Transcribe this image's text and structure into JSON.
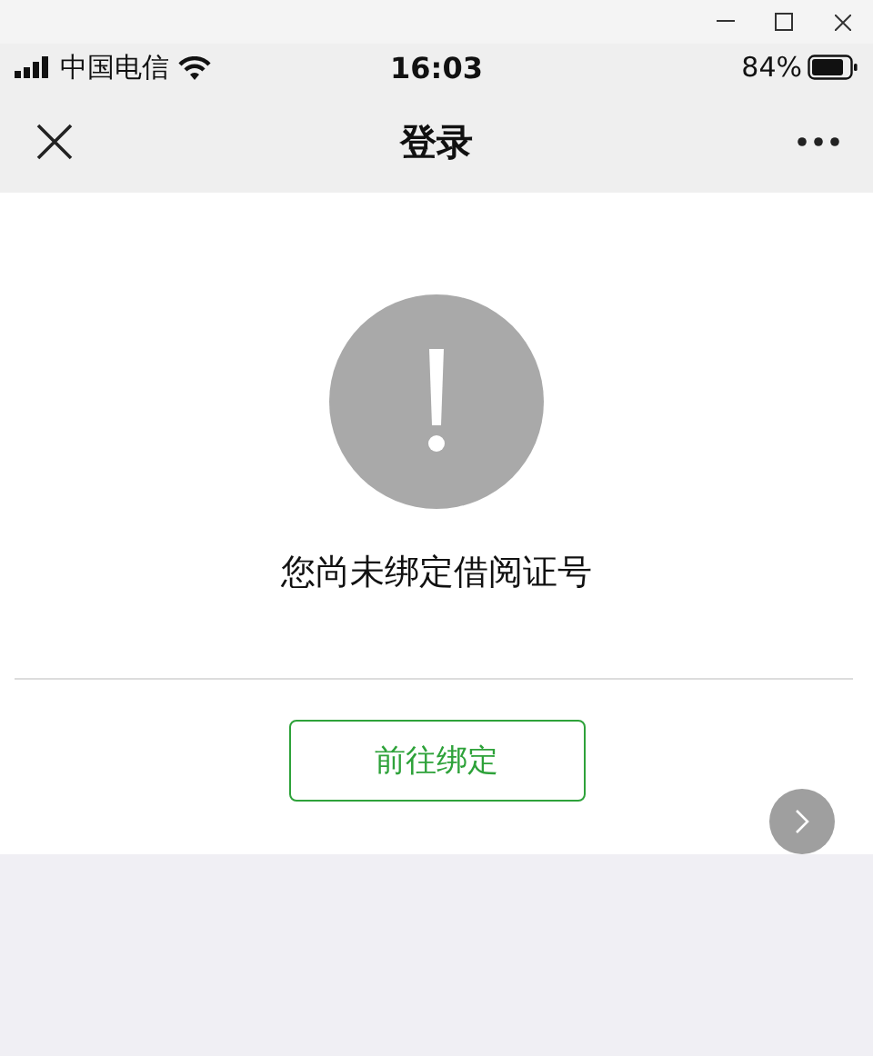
{
  "status_bar": {
    "carrier": "中国电信",
    "time": "16:03",
    "battery": "84%"
  },
  "nav": {
    "title": "登录"
  },
  "message": "您尚未绑定借阅证号",
  "bind_button": "前往绑定"
}
